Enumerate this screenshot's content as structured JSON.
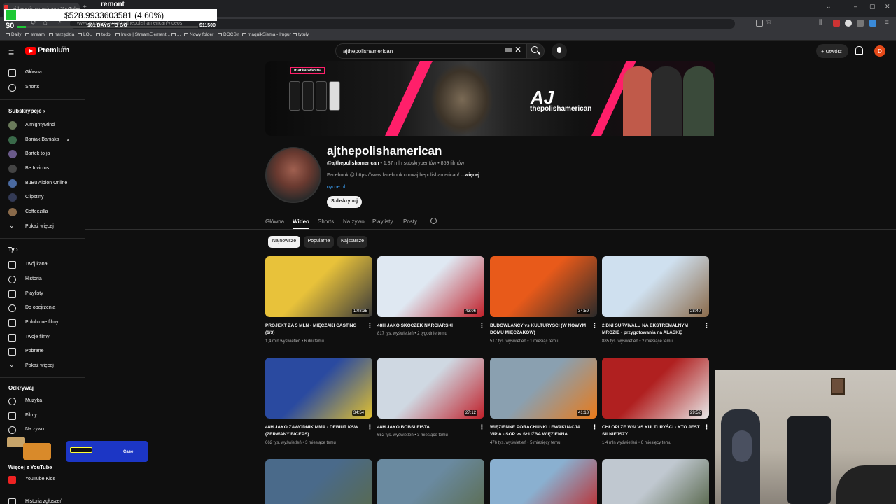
{
  "browser": {
    "tab_title": "ajthepolishamerican - YouTube",
    "url": "www.youtube.com/@ajthepolishamerican/videos",
    "bookmarks": [
      "Daily",
      "stream",
      "narzędzia",
      "LOL",
      "todo",
      "Iruke | StreamElement...",
      "...",
      "Nowy folder",
      "DOCSY",
      "maquikSiema - Imgur",
      "tytuły"
    ]
  },
  "overlay": {
    "ticker": "$528.9933603581 (4.60%)",
    "remont": "remont",
    "days": "161 DAYS TO GO",
    "start": "$0",
    "goal": "$11500",
    "progress": 0.046,
    "case_label": "Case"
  },
  "yt": {
    "brand": "Premium",
    "region": "PL",
    "search_value": "ajthepolishamerican",
    "create": "Utwórz",
    "avatar_letter": "D"
  },
  "sidebar": {
    "main": [
      "Główna",
      "Shorts"
    ],
    "subs_head": "Subskrypcje",
    "subs": [
      {
        "label": "AlmightyMind",
        "color": "#6a7a5a"
      },
      {
        "label": "Baniak Baniaka",
        "color": "#3a6a4a"
      },
      {
        "label": "Bartek to ja",
        "color": "#6a5a8a"
      },
      {
        "label": "Be Invictus",
        "color": "#444444"
      },
      {
        "label": "BuBu Albion Online",
        "color": "#4a6aa0"
      },
      {
        "label": "Clipstiny",
        "color": "#333a55"
      },
      {
        "label": "Coffeezilla",
        "color": "#8a6a4a"
      }
    ],
    "show_more": "Pokaż więcej",
    "you_head": "Ty",
    "you": [
      "Twój kanał",
      "Historia",
      "Playlisty",
      "Do obejrzenia",
      "Polubione filmy",
      "Twoje filmy",
      "Pobrane",
      "Pokaż więcej"
    ],
    "explore_head": "Odkrywaj",
    "explore": [
      "Muzyka",
      "Filmy",
      "Na żywo"
    ],
    "more_head": "Więcej z YouTube",
    "more": [
      "YouTube Kids",
      "Historia zgłoszeń"
    ]
  },
  "channel": {
    "name": "ajthepolishamerican",
    "handle": "@ajthepolishamerican",
    "meta": " • 1,37 mln subskrybentów • 859 filmów",
    "desc": "Facebook @ https://www.facebook.com/ajthepolishamerican/ ",
    "more": "...więcej",
    "link": "oyche.pl",
    "subscribe": "Subskrybuj",
    "banner_label": "marka własna",
    "banner_aj": "AJ",
    "banner_name": "thepolishamerican",
    "tabs": [
      "Główna",
      "Wideo",
      "Shorts",
      "Na żywo",
      "Playlisty",
      "Posty"
    ],
    "chips": [
      "Najnowsze",
      "Popularne",
      "Najstarsze"
    ]
  },
  "videos": [
    {
      "title": "PROJEKT ZA 5 MLN - MIĘCZAKI CASTING (1/3)",
      "views": "1,4 mln wyświetleń",
      "age": "6 dni temu",
      "dur": "1:08:35",
      "c1": "#e8c23a",
      "c2": "#3a3a3a"
    },
    {
      "title": "48H JAKO SKOCZEK NARCIARSKI",
      "views": "817 tys. wyświetleń",
      "age": "2 tygodnie temu",
      "dur": "43:06",
      "c1": "#dfe8f2",
      "c2": "#c0202a"
    },
    {
      "title": "BUDOWLAŃCY vs KULTURYŚCI (W NOWYM DOMU MIĘCZAKÓW)",
      "views": "517 tys. wyświetleń",
      "age": "1 miesiąc temu",
      "dur": "34:59",
      "c1": "#e85a1a",
      "c2": "#2a2a2a"
    },
    {
      "title": "2 DNI SURVIVALU NA EKSTREMALNYM MROZIE - przygotowania na ALASKĘ",
      "views": "885 tys. wyświetleń",
      "age": "2 miesiące temu",
      "dur": "28:40",
      "c1": "#cfe0ef",
      "c2": "#8a6a4a"
    },
    {
      "title": "48H JAKO ZAWODNIK MMA - DEBIUT KSW (ZERWANY BICEPS)",
      "views": "662 tys. wyświetleń",
      "age": "3 miesiące temu",
      "dur": "34:54",
      "c1": "#2a4aa0",
      "c2": "#e0c030"
    },
    {
      "title": "48H JAKO BOBSLEISTA",
      "views": "652 tys. wyświetleń",
      "age": "3 miesiące temu",
      "dur": "27:12",
      "c1": "#cfd8e2",
      "c2": "#c0202a"
    },
    {
      "title": "WIĘZIENNE PORACHUNKI I EWAKUACJA VIP'A - SOP vs SŁUŻBA WIĘZIENNA",
      "views": "476 tys. wyświetleń",
      "age": "5 miesięcy temu",
      "dur": "41:18",
      "c1": "#8aa0b0",
      "c2": "#e87a1a"
    },
    {
      "title": "CHŁOPI ZE WSI VS KULTURYŚCI - KTO JEST SILNIEJSZY",
      "views": "1,4 mln wyświetleń",
      "age": "6 miesięcy temu",
      "dur": "29:52",
      "c1": "#b02020",
      "c2": "#e8e8e8"
    },
    {
      "title": "",
      "views": "",
      "age": "",
      "dur": "",
      "c1": "#4a6a8a",
      "c2": "#5a6a4a"
    },
    {
      "title": "",
      "views": "",
      "age": "",
      "dur": "",
      "c1": "#6a8aa0",
      "c2": "#5a6a4a"
    },
    {
      "title": "",
      "views": "",
      "age": "",
      "dur": "",
      "c1": "#8ab0d0",
      "c2": "#c02020"
    },
    {
      "title": "",
      "views": "",
      "age": "",
      "dur": "",
      "c1": "#c0c8d0",
      "c2": "#4a5a3a"
    }
  ]
}
